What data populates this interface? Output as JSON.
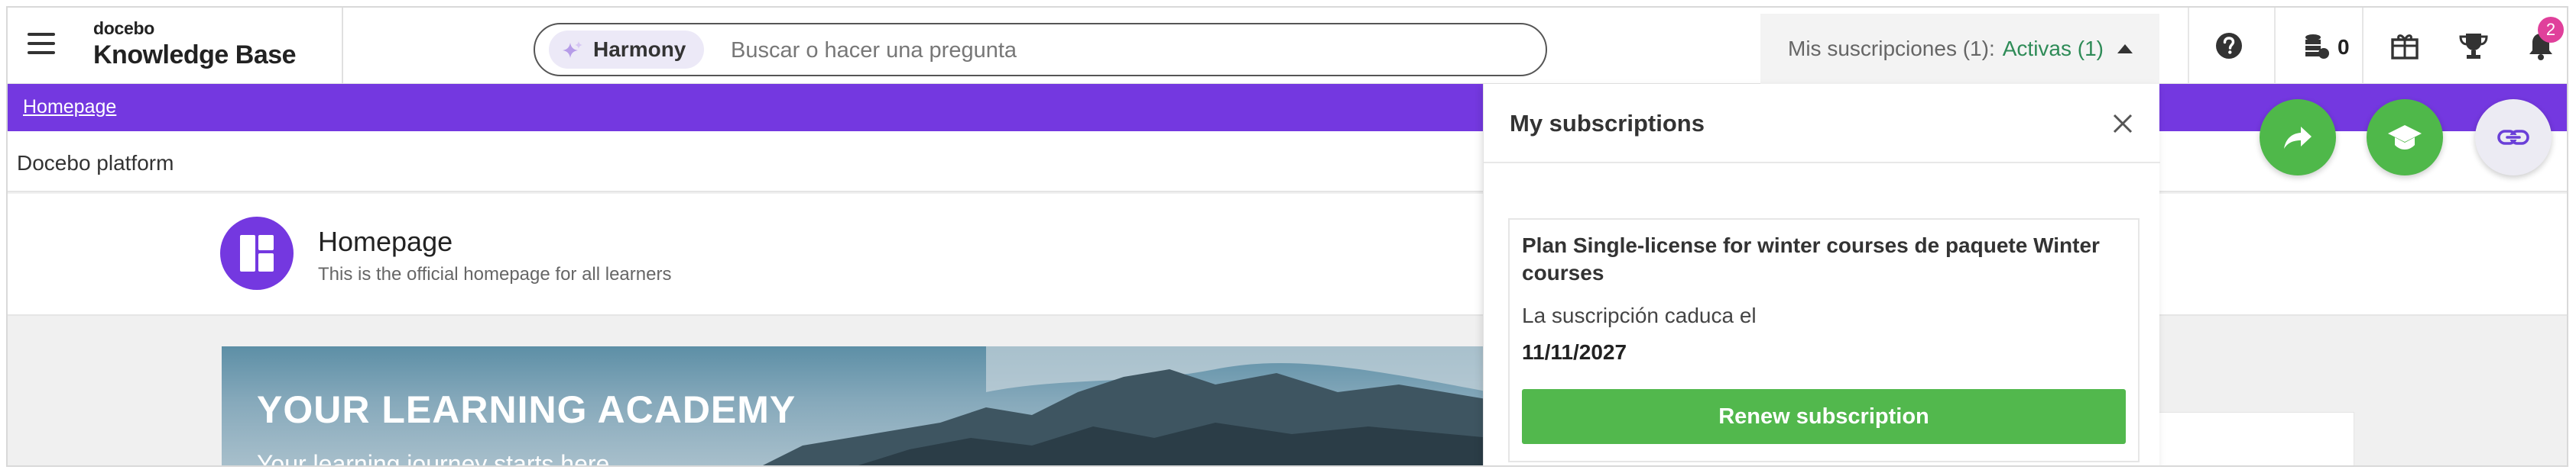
{
  "header": {
    "logo_brand": "docebo",
    "logo_title": "Knowledge Base",
    "search": {
      "harmony_label": "Harmony",
      "placeholder": "Buscar o hacer una pregunta"
    },
    "subscriptions_toggle": {
      "label": "Mis suscripciones (1):",
      "status": "Activas (1)"
    },
    "coins_count": "0",
    "notification_count": "2",
    "icons": [
      "menu-icon",
      "help-icon",
      "coins-icon",
      "gift-icon",
      "trophy-icon",
      "bell-icon"
    ]
  },
  "breadcrumb": {
    "home": "Homepage"
  },
  "platform": {
    "label": "Docebo platform"
  },
  "page": {
    "title": "Homepage",
    "subtitle": "This is the official homepage for all learners"
  },
  "hero": {
    "title": "YOUR LEARNING ACADEMY",
    "subtitle": "Your learning journey starts here"
  },
  "subscriptions_panel": {
    "title": "My subscriptions",
    "plan_name": "Plan Single-license for winter courses de paquete Winter courses",
    "expiry_label": "La suscripción caduca el",
    "expiry_date": "11/11/2027",
    "renew_label": "Renew subscription"
  },
  "colors": {
    "brand_purple": "#7438e0",
    "action_green": "#52b84d",
    "active_green": "#2e8b57",
    "badge_pink": "#e0409b"
  }
}
